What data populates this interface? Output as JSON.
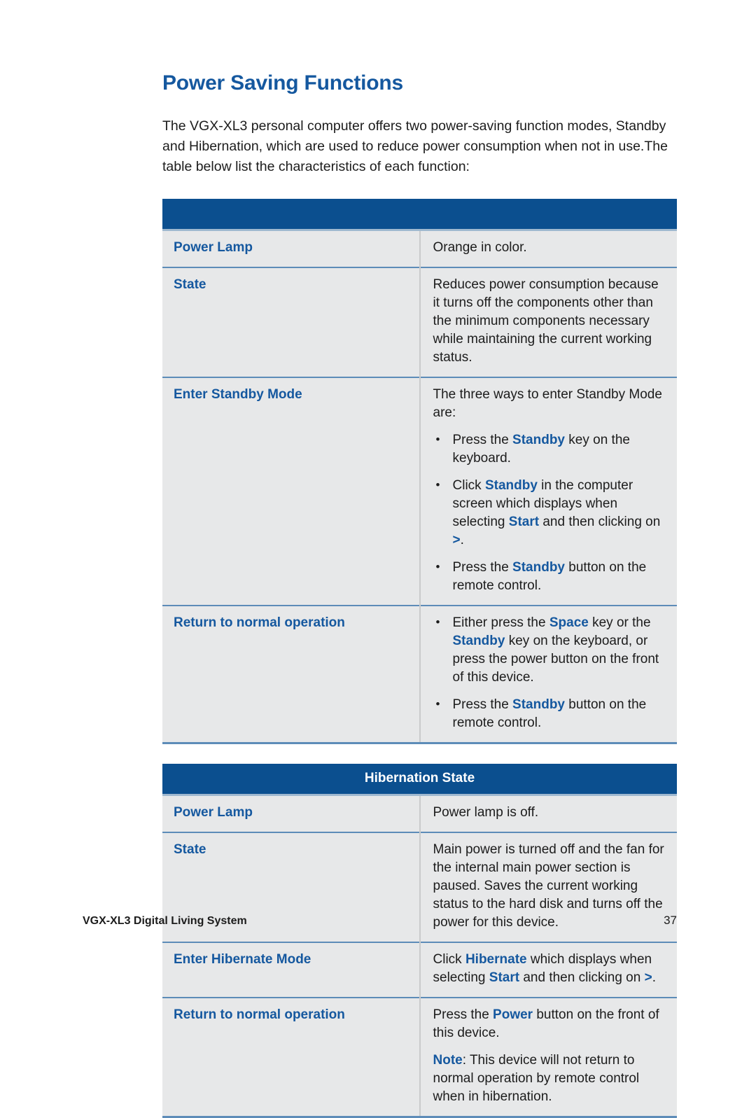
{
  "document": {
    "title": "Power Saving Functions",
    "intro": "The VGX-XL3 personal computer offers two power-saving function modes, Standby and Hibernation, which are used to reduce power consumption when not in use.The table below list the characteristics of each function:"
  },
  "colors": {
    "heading_blue": "#15589f",
    "header_bar_blue": "#0b4f8f",
    "row_background": "#e7e8e9",
    "separator_blue": "#5d8cb8",
    "keyword_blue": "#15589f"
  },
  "standby_table": {
    "header": "",
    "rows": [
      {
        "label": "Power Lamp",
        "text": "Orange in color."
      },
      {
        "label": "State",
        "text": "Reduces power consumption because it turns off the components other than the minimum components necessary while maintaining the current working status."
      },
      {
        "label": "Enter Standby Mode",
        "lead": "The three ways to enter Standby Mode are:",
        "bullets": [
          {
            "parts": [
              {
                "t": "Press the ",
                "b": false
              },
              {
                "t": "Standby",
                "b": true
              },
              {
                "t": " key on the keyboard.",
                "b": false
              }
            ]
          },
          {
            "parts": [
              {
                "t": "Click ",
                "b": false
              },
              {
                "t": "Standby",
                "b": true
              },
              {
                "t": " in the computer screen which displays when selecting ",
                "b": false
              },
              {
                "t": "Start",
                "b": true
              },
              {
                "t": " and then clicking on ",
                "b": false
              },
              {
                "t": ">",
                "b": true
              },
              {
                "t": ".",
                "b": false
              }
            ]
          },
          {
            "parts": [
              {
                "t": "Press the ",
                "b": false
              },
              {
                "t": "Standby",
                "b": true
              },
              {
                "t": " button on the remote control.",
                "b": false
              }
            ]
          }
        ]
      },
      {
        "label": "Return to normal operation",
        "bullets": [
          {
            "parts": [
              {
                "t": "Either press the ",
                "b": false
              },
              {
                "t": "Space",
                "b": true
              },
              {
                "t": " key or the ",
                "b": false
              },
              {
                "t": "Standby",
                "b": true
              },
              {
                "t": " key on the keyboard, or press the power button on the front of this device.",
                "b": false
              }
            ]
          },
          {
            "parts": [
              {
                "t": "Press the ",
                "b": false
              },
              {
                "t": "Standby",
                "b": true
              },
              {
                "t": " button on the remote control.",
                "b": false
              }
            ]
          }
        ]
      }
    ]
  },
  "hibernation_table": {
    "header": "Hibernation State",
    "rows": [
      {
        "label": "Power Lamp",
        "text": "Power lamp is off."
      },
      {
        "label": "State",
        "text": "Main power is turned off and the fan for the internal main power section is paused. Saves the current working status to the hard disk and turns off the power for this device."
      },
      {
        "label": "Enter Hibernate Mode",
        "paragraphs": [
          {
            "parts": [
              {
                "t": "Click ",
                "b": false
              },
              {
                "t": "Hibernate",
                "b": true
              },
              {
                "t": " which displays when selecting ",
                "b": false
              },
              {
                "t": "Start",
                "b": true
              },
              {
                "t": " and then clicking on ",
                "b": false
              },
              {
                "t": ">",
                "b": true
              },
              {
                "t": ".",
                "b": false
              }
            ]
          }
        ]
      },
      {
        "label": "Return to normal operation",
        "paragraphs": [
          {
            "parts": [
              {
                "t": "Press the ",
                "b": false
              },
              {
                "t": "Power",
                "b": true
              },
              {
                "t": " button on the front of this device.",
                "b": false
              }
            ]
          },
          {
            "parts": [
              {
                "t": "Note",
                "b": true
              },
              {
                "t": ": This device will not return to normal operation by remote control when in hibernation.",
                "b": false
              }
            ]
          }
        ]
      }
    ]
  },
  "footer": {
    "left": "VGX-XL3 Digital Living System",
    "page_number": "37"
  }
}
